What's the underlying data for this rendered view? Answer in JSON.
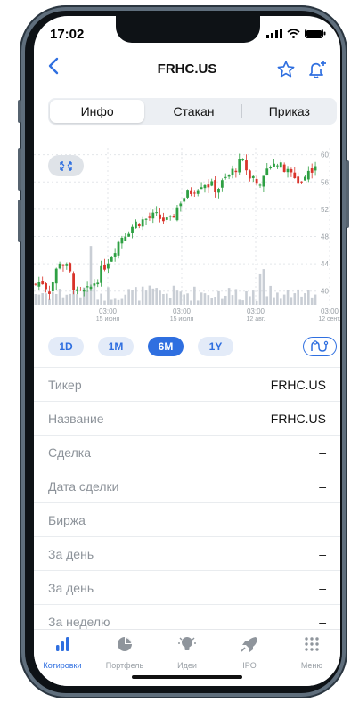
{
  "status": {
    "time": "17:02"
  },
  "header": {
    "title": "FRHC.US"
  },
  "segments": [
    {
      "label": "Инфо",
      "active": true
    },
    {
      "label": "Стакан",
      "active": false
    },
    {
      "label": "Приказ",
      "active": false
    }
  ],
  "chart_data": {
    "type": "candlestick",
    "y_ticks": [
      "60",
      "56",
      "52",
      "48",
      "44",
      "40"
    ],
    "ylim": [
      38,
      61
    ],
    "x_ticks": [
      {
        "time": "03:00",
        "date": "15 июня"
      },
      {
        "time": "03:00",
        "date": "15 июля"
      },
      {
        "time": "03:00",
        "date": "12 авг."
      },
      {
        "time": "03:00",
        "date": "12 сент."
      }
    ],
    "colors": {
      "up": "#2ea043",
      "down": "#d9342b",
      "volume": "#c9ced5"
    }
  },
  "periods": [
    {
      "label": "1D",
      "active": false
    },
    {
      "label": "1M",
      "active": false
    },
    {
      "label": "6M",
      "active": true
    },
    {
      "label": "1Y",
      "active": false
    }
  ],
  "info": [
    {
      "label": "Тикер",
      "value": "FRHC.US"
    },
    {
      "label": "Название",
      "value": "FRHC.US"
    },
    {
      "label": "Сделка",
      "value": "–"
    },
    {
      "label": "Дата сделки",
      "value": "–"
    },
    {
      "label": "Биржа",
      "value": ""
    },
    {
      "label": "За день",
      "value": "–"
    },
    {
      "label": "За день",
      "value": "–"
    },
    {
      "label": "За неделю",
      "value": "–"
    }
  ],
  "tabbar": [
    {
      "label": "Котировки",
      "icon": "bars-icon",
      "active": true
    },
    {
      "label": "Портфель",
      "icon": "pie-icon",
      "active": false
    },
    {
      "label": "Идеи",
      "icon": "bulb-icon",
      "active": false
    },
    {
      "label": "IPO",
      "icon": "rocket-icon",
      "active": false
    },
    {
      "label": "Меню",
      "icon": "grid-icon",
      "active": false
    }
  ],
  "accent": "#2f6fe0"
}
